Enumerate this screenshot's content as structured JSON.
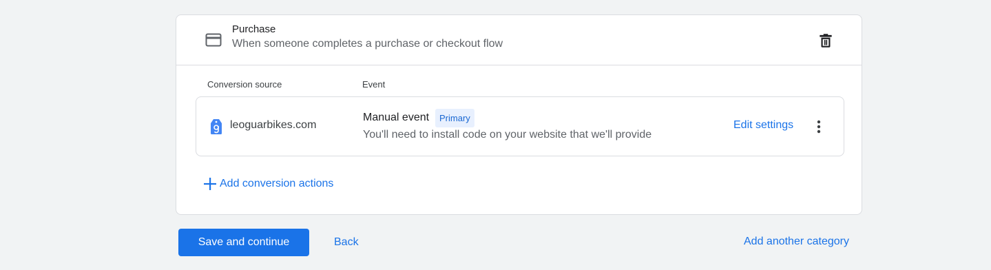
{
  "goal": {
    "icon": "credit-card-icon",
    "title": "Purchase",
    "subtitle": "When someone completes a purchase or checkout flow",
    "delete_icon": "trash-icon"
  },
  "table": {
    "headers": {
      "source": "Conversion source",
      "event": "Event"
    },
    "rows": [
      {
        "source_icon": "google-tag-icon",
        "source": "leoguarbikes.com",
        "event_name": "Manual event",
        "badge": "Primary",
        "description": "You'll need to install code on your website that we'll provide",
        "action": "Edit settings",
        "menu_icon": "more-vert-icon"
      }
    ]
  },
  "add_actions_label": "Add conversion actions",
  "footer": {
    "save_label": "Save and continue",
    "back_label": "Back",
    "add_category_label": "Add another category"
  },
  "colors": {
    "accent": "#1a73e8",
    "badge_bg": "#e8f0fe",
    "page_bg": "#f1f3f4"
  }
}
